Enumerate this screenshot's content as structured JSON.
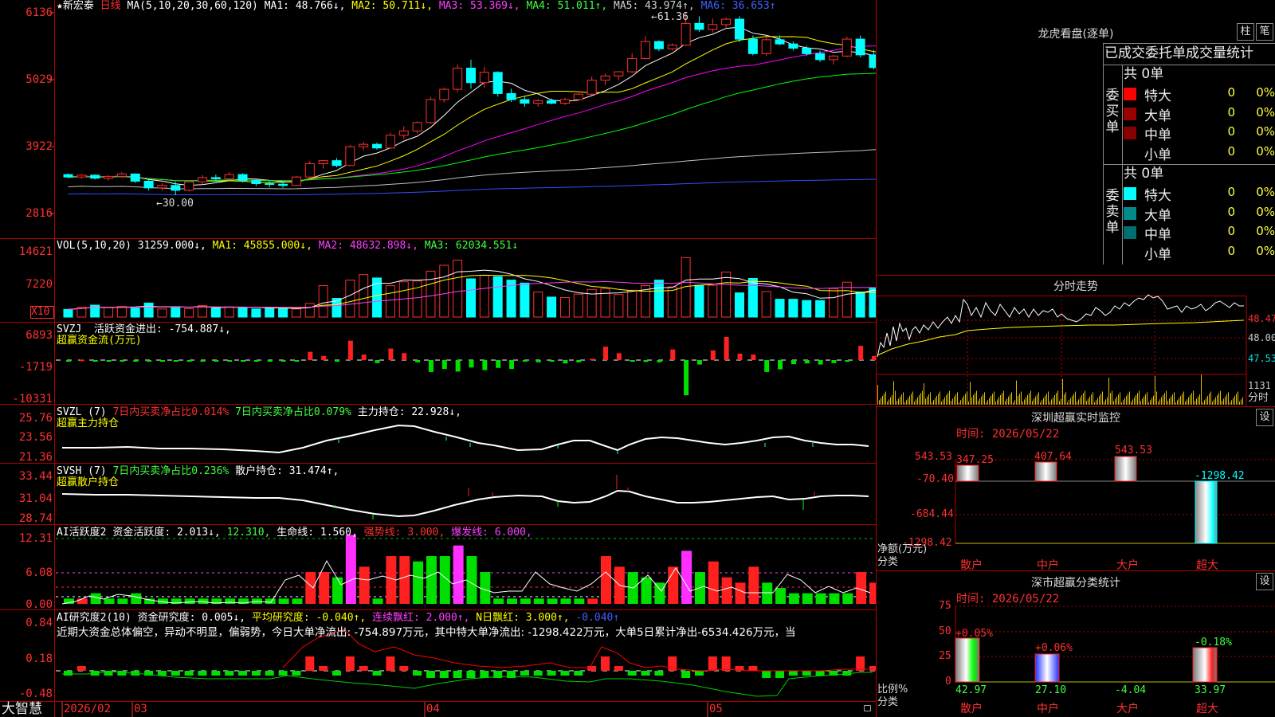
{
  "stock": {
    "name": "★新宏泰",
    "period": "日线",
    "ma_label": "MA(5,10,20,30,60,120)",
    "ma": [
      {
        "label": "MA1: 48.766↓,",
        "color": "#ffffff"
      },
      {
        "label": "MA2: 50.711↓,",
        "color": "#ffff00"
      },
      {
        "label": "MA3: 53.369↓,",
        "color": "#ff00ff"
      },
      {
        "label": "MA4: 51.011↑,",
        "color": "#00ff00"
      },
      {
        "label": "MA5: 43.974↑,",
        "color": "#c0c0c0"
      },
      {
        "label": "MA6: 36.653↑",
        "color": "#3050ff"
      }
    ],
    "price_axis": [
      "6136",
      "5029",
      "3922",
      "2816"
    ],
    "high_label": "←61.36",
    "low_label": "←30.00"
  },
  "vol": {
    "title": "VOL(5,10,20)",
    "value": "31259.000↓,",
    "ma1": "MA1: 45855.000↓,",
    "ma2": "MA2: 48632.898↓,",
    "ma3": "MA3: 62034.551↓",
    "axis": [
      "14621",
      "7220"
    ],
    "unit": "X10"
  },
  "svzj": {
    "title": "SVZJ",
    "line1": "活跃资金进出: -754.887↓,",
    "line2": "超赢资金流(万元)",
    "axis": [
      "6893",
      "-1719",
      "-10331"
    ]
  },
  "svzl": {
    "title": "SVZL (7)",
    "item1": "7日内买卖净占比0.014%",
    "item2": "7日内买卖净占比0.079%",
    "item3": "主力持仓: 22.928↓,",
    "line2": "超赢主力持仓",
    "axis": [
      "25.76",
      "23.56",
      "21.36"
    ]
  },
  "svsh": {
    "title": "SVSH (7)",
    "item1": "7日内买卖净占比0.236%",
    "item2": "散户持仓: 31.474↑,",
    "line2": "超赢散户持仓",
    "axis": [
      "33.44",
      "31.04",
      "28.74"
    ]
  },
  "ai1": {
    "title": "AI活跃度2",
    "item1": "资金活跃度: 2.013↓,",
    "item2": "12.310,",
    "item3": "生命线: 1.560,",
    "item4": "强势线: 3.000,",
    "item5": "爆发线: 6.000,",
    "axis": [
      "12.31",
      "6.08",
      "0.00"
    ]
  },
  "ai2": {
    "title": "AI研究度2(10)",
    "item1": "资金研究度: 0.005↓,",
    "item2": "平均研究度: -0.040↑,",
    "item3": "连续飘红: 2.000↑,",
    "item4": "N日飘红: 3.000↑,",
    "item5": "-0.040↑",
    "comment": "近期大资金总体偏空，异动不明显，偏弱势，今日大单净流出: -754.897万元，其中特大单净流出: -1298.422万元，大单5日累计净出-6534.426万元，当",
    "axis": [
      "0.84",
      "0.18",
      "-0.48"
    ]
  },
  "bottom": {
    "brand": "大智慧",
    "dates": [
      "2026/02",
      "03",
      "04",
      "05"
    ]
  },
  "dragon": {
    "title": "龙虎看盘(逐单)",
    "btn1": "柱",
    "btn2": "笔",
    "header": "已成交委托单成交量统计",
    "buy": {
      "vlabel": "委买单",
      "count": "共 0单",
      "rows": [
        {
          "label": "特大",
          "value": "0",
          "pct": "0%",
          "color": "#ff0000"
        },
        {
          "label": "大单",
          "value": "0",
          "pct": "0%",
          "color": "#990000"
        },
        {
          "label": "中单",
          "value": "0",
          "pct": "0%",
          "color": "#880000"
        },
        {
          "label": "小单",
          "value": "0",
          "pct": "0%",
          "color": ""
        }
      ]
    },
    "sell": {
      "vlabel": "委卖单",
      "count": "共 0单",
      "rows": [
        {
          "label": "特大",
          "value": "0",
          "pct": "0%",
          "color": "#00ffff"
        },
        {
          "label": "大单",
          "value": "0",
          "pct": "0%",
          "color": "#008b8b"
        },
        {
          "label": "中单",
          "value": "0",
          "pct": "0%",
          "color": "#006f6f"
        },
        {
          "label": "小单",
          "value": "0",
          "pct": "0%",
          "color": ""
        }
      ]
    }
  },
  "intraday": {
    "title": "分时走势",
    "axis": [
      "48.47",
      "48.00",
      "47.53"
    ],
    "vol_label": "1131",
    "unit_label": "分时"
  },
  "sz_monitor": {
    "title": "深圳超赢实时监控",
    "btn": "设",
    "time": "时间: 2026/05/22",
    "axis": [
      "543.53",
      "-70.40",
      "-684.44",
      "-1298.42"
    ],
    "ylabel": "净额(万元)",
    "xlabel": "分类"
  },
  "sz_class": {
    "title": "深市超赢分类统计",
    "btn": "设",
    "time": "时间: 2026/05/22",
    "axis": [
      "75",
      "50",
      "25",
      "0"
    ],
    "ylabel": "比例%",
    "xlabel": "分类"
  },
  "chart_data": [
    {
      "type": "candlestick",
      "title": "新宏泰 日线",
      "ylim": [
        28.16,
        61.36
      ],
      "y_ticks": [
        61.36,
        50.29,
        39.22,
        28.16
      ],
      "x_ticks": [
        "2026/02",
        "03",
        "04",
        "05"
      ],
      "ohlc": [
        [
          34.6,
          34.8,
          34.0,
          34.2
        ],
        [
          34.2,
          34.7,
          33.9,
          34.5
        ],
        [
          34.5,
          34.6,
          33.8,
          34.0
        ],
        [
          34.0,
          34.5,
          33.6,
          34.3
        ],
        [
          34.3,
          35.0,
          34.1,
          34.7
        ],
        [
          34.7,
          34.8,
          33.2,
          33.5
        ],
        [
          33.5,
          33.7,
          32.0,
          32.4
        ],
        [
          32.4,
          33.2,
          31.9,
          32.8
        ],
        [
          32.8,
          33.4,
          31.2,
          32.0
        ],
        [
          32.0,
          33.6,
          31.8,
          33.4
        ],
        [
          33.4,
          34.5,
          33.0,
          34.1
        ],
        [
          34.1,
          34.6,
          33.5,
          33.9
        ],
        [
          33.9,
          35.0,
          33.7,
          34.6
        ],
        [
          34.6,
          34.8,
          33.3,
          33.6
        ],
        [
          33.6,
          33.8,
          32.7,
          33.1
        ],
        [
          33.1,
          33.6,
          32.5,
          33.0
        ],
        [
          33.0,
          33.5,
          32.4,
          32.8
        ],
        [
          32.8,
          34.4,
          32.7,
          34.2
        ],
        [
          34.2,
          36.8,
          34.0,
          36.4
        ],
        [
          36.4,
          37.0,
          35.6,
          36.9
        ],
        [
          36.9,
          37.3,
          35.8,
          36.1
        ],
        [
          36.1,
          39.5,
          36.0,
          39.2
        ],
        [
          39.2,
          40.0,
          38.6,
          39.6
        ],
        [
          39.6,
          39.9,
          38.7,
          39.0
        ],
        [
          39.0,
          41.5,
          38.9,
          41.1
        ],
        [
          41.1,
          42.6,
          40.5,
          41.8
        ],
        [
          41.8,
          43.4,
          41.4,
          43.2
        ],
        [
          43.2,
          47.4,
          43.0,
          47.0
        ],
        [
          47.0,
          49.0,
          46.5,
          48.7
        ],
        [
          48.7,
          52.8,
          48.2,
          52.2
        ],
        [
          52.2,
          53.6,
          48.8,
          49.8
        ],
        [
          49.8,
          52.4,
          48.9,
          51.5
        ],
        [
          51.5,
          51.7,
          47.5,
          48.0
        ],
        [
          48.0,
          48.8,
          46.6,
          47.0
        ],
        [
          47.0,
          47.5,
          45.8,
          46.4
        ],
        [
          46.4,
          47.1,
          45.8,
          46.8
        ],
        [
          46.8,
          47.2,
          46.2,
          46.4
        ],
        [
          46.4,
          47.3,
          46.1,
          47.0
        ],
        [
          47.0,
          48.1,
          46.8,
          47.9
        ],
        [
          47.9,
          50.8,
          47.7,
          50.2
        ],
        [
          50.2,
          51.3,
          49.4,
          50.9
        ],
        [
          50.9,
          51.7,
          50.2,
          51.6
        ],
        [
          51.6,
          54.7,
          51.4,
          53.8
        ],
        [
          53.8,
          57.5,
          53.6,
          56.6
        ],
        [
          56.6,
          56.8,
          55.0,
          55.4
        ],
        [
          55.4,
          56.3,
          55.1,
          56.0
        ],
        [
          56.0,
          61.4,
          55.9,
          59.6
        ],
        [
          59.6,
          60.8,
          58.2,
          58.6
        ],
        [
          58.6,
          60.4,
          58.1,
          59.4
        ],
        [
          59.4,
          60.6,
          58.9,
          60.3
        ],
        [
          60.3,
          60.8,
          56.5,
          57.0
        ],
        [
          57.0,
          57.6,
          54.3,
          54.6
        ],
        [
          54.6,
          57.3,
          54.2,
          56.9
        ],
        [
          56.9,
          57.6,
          56.0,
          56.2
        ],
        [
          56.2,
          56.6,
          55.1,
          55.5
        ],
        [
          55.5,
          55.9,
          54.2,
          54.6
        ],
        [
          54.6,
          55.1,
          53.2,
          53.6
        ],
        [
          53.6,
          54.4,
          52.8,
          54.2
        ],
        [
          54.2,
          57.4,
          54.0,
          57.0
        ],
        [
          57.0,
          57.6,
          54.0,
          54.4
        ],
        [
          54.4,
          55.2,
          52.0,
          52.3
        ],
        [
          52.3,
          52.5,
          50.7,
          51.1
        ],
        [
          51.1,
          52.8,
          50.5,
          52.6
        ],
        [
          52.6,
          52.8,
          51.2,
          51.4
        ],
        [
          51.4,
          51.6,
          50.5,
          50.7
        ],
        [
          50.7,
          51.0,
          50.1,
          50.4
        ]
      ],
      "series": [
        {
          "name": "MA1",
          "color": "#ffffff"
        },
        {
          "name": "MA2",
          "color": "#ffff00"
        },
        {
          "name": "MA3",
          "color": "#ff00ff"
        },
        {
          "name": "MA4",
          "color": "#00ff00"
        },
        {
          "name": "MA5",
          "color": "#c0c0c0"
        },
        {
          "name": "MA6",
          "color": "#3050ff"
        }
      ]
    },
    {
      "type": "bar",
      "title": "VOL(5,10,20)",
      "ylim": [
        0,
        14621
      ],
      "y_ticks": [
        14621,
        7220
      ],
      "values": [
        1800,
        2300,
        2800,
        2200,
        2500,
        2100,
        3300,
        1900,
        2400,
        2000,
        2700,
        2100,
        2400,
        2300,
        1900,
        2100,
        2000,
        1900,
        3200,
        7400,
        4400,
        8700,
        10000,
        9200,
        7400,
        8300,
        8500,
        10800,
        12200,
        13400,
        9000,
        9800,
        9500,
        8700,
        8000,
        5900,
        4700,
        4600,
        5400,
        6500,
        6700,
        5300,
        6300,
        7400,
        8700,
        7100,
        14000,
        7500,
        7500,
        10600,
        5700,
        9100,
        6000,
        4200,
        4200,
        3900,
        3900,
        6700,
        8200,
        5900,
        6800,
        4700,
        5100,
        4300,
        4200,
        3100
      ]
    },
    {
      "type": "bar",
      "title": "SVZJ 活跃资金进出",
      "ylim": [
        -10331,
        6893
      ],
      "y_ticks": [
        6893,
        -1719,
        -10331
      ],
      "values": [
        -80,
        120,
        -60,
        -180,
        -220,
        -150,
        -300,
        -210,
        -170,
        -180,
        -160,
        -140,
        -130,
        -170,
        -200,
        -190,
        -190,
        -160,
        1800,
        900,
        -400,
        4200,
        1200,
        -800,
        2500,
        1500,
        -600,
        -3200,
        -2400,
        -3100,
        -2000,
        -2700,
        -2100,
        -2400,
        -300,
        -600,
        -400,
        -900,
        -600,
        300,
        2900,
        1500,
        -300,
        -500,
        -600,
        2300,
        -9500,
        -1200,
        2100,
        5000,
        1400,
        1200,
        -3200,
        -2500,
        -1100,
        -900,
        -1200,
        -800,
        -200,
        3100,
        900,
        -2900,
        -600,
        -300,
        -300,
        -200
      ]
    }
  ]
}
